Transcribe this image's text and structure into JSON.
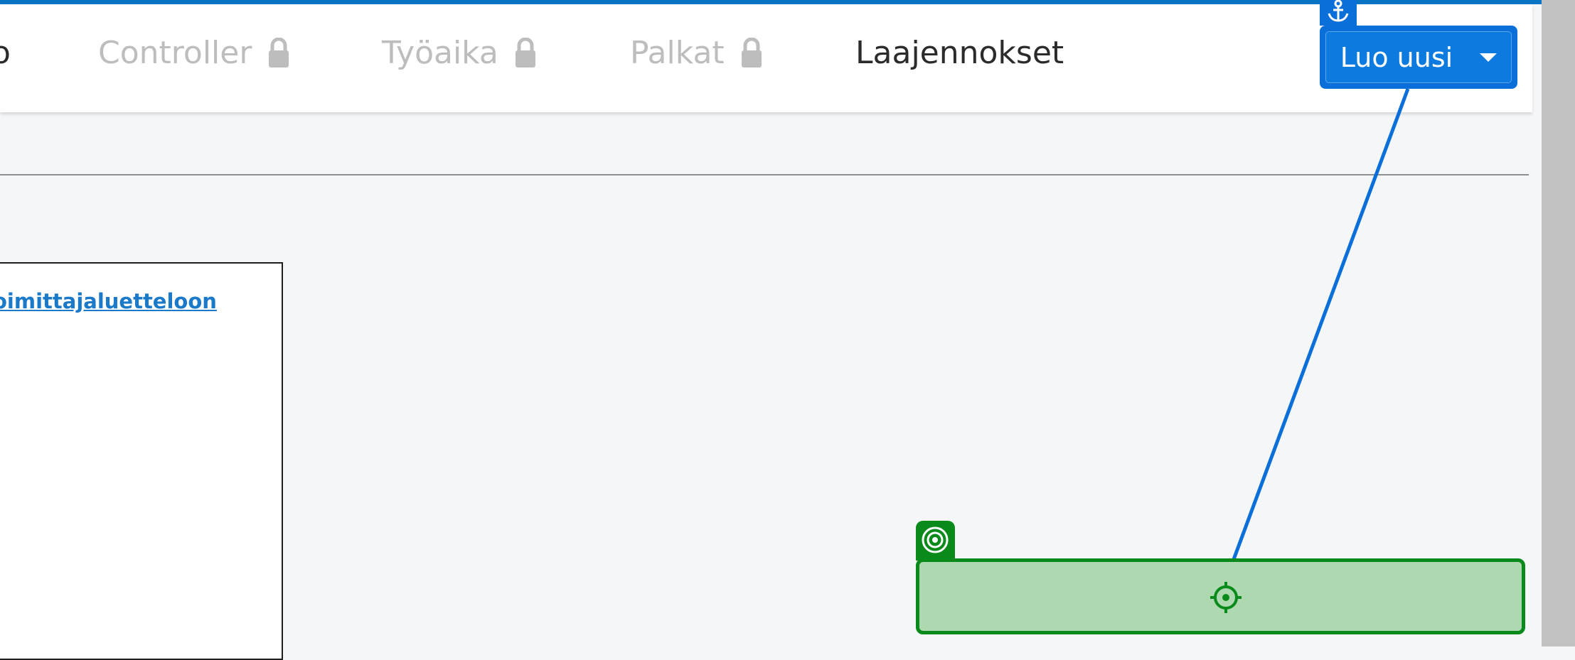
{
  "navbar": {
    "items": [
      {
        "label": "o",
        "locked": false,
        "active": true
      },
      {
        "label": "Controller",
        "locked": true,
        "active": false
      },
      {
        "label": "Työaika",
        "locked": true,
        "active": false
      },
      {
        "label": "Palkat",
        "locked": true,
        "active": false
      },
      {
        "label": "Laajennokset",
        "locked": false,
        "active": true
      }
    ]
  },
  "create_button": {
    "label": "Luo uusi"
  },
  "card": {
    "link_text": "oimittajaluetteloon"
  },
  "colors": {
    "accent": "#0a74c4",
    "anchor_blue": "#0a6fd8",
    "target_green": "#0a8a1a",
    "target_fill": "#aed8b0",
    "link": "#1b79c9",
    "nav_disabled": "#bdbdbd"
  },
  "icons": {
    "lock": "lock-icon",
    "caret": "caret-down-icon",
    "anchor": "anchor-icon",
    "target": "target-icon",
    "crosshair": "crosshair-icon"
  }
}
